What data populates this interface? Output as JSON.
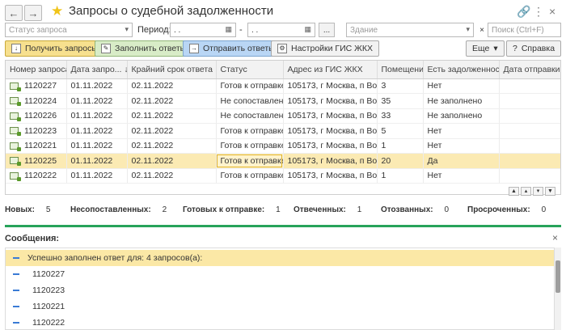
{
  "window": {
    "title": "Запросы о судебной задолженности",
    "back_icon": "←",
    "forward_icon": "→"
  },
  "filters": {
    "status_placeholder": "Статус запроса",
    "period_label": "Период:",
    "date_from": " .  .",
    "date_separator": "-",
    "date_to": " .  .",
    "period_button": "...",
    "building_placeholder": "Здание",
    "more_label": "Еще",
    "search_placeholder": "Поиск (Ctrl+F)"
  },
  "toolbar": {
    "get_requests": "Получить запросы",
    "fill_answers": "Заполнить ответы",
    "send_answers": "Отправить ответы",
    "gis_settings": "Настройки ГИС ЖКХ",
    "more": "Еще",
    "help": "Справка",
    "colors": {
      "get": "#f7e08e",
      "fill": "#d8ecc7",
      "send": "#b9d6f5",
      "neutral": "#f2f2f2"
    }
  },
  "table": {
    "headers": [
      "Номер запроса",
      "Дата запро...",
      "Крайний срок ответа",
      "Статус",
      "Адрес из ГИС ЖКХ",
      "Помещение",
      "Есть задолженность",
      "Дата отправки"
    ],
    "sort_indicator": "↓",
    "rows": [
      {
        "num": "1120227",
        "date": "01.11.2022",
        "deadline": "02.11.2022",
        "status": "Готов к отправке",
        "address": "105173, г Москва, п Во...",
        "room": "3",
        "debt": "Нет",
        "sent": ""
      },
      {
        "num": "1120224",
        "date": "01.11.2022",
        "deadline": "02.11.2022",
        "status": "Не сопоставлен",
        "address": "105173, г Москва, п Во...",
        "room": "35",
        "debt": "Не заполнено",
        "sent": ""
      },
      {
        "num": "1120226",
        "date": "01.11.2022",
        "deadline": "02.11.2022",
        "status": "Не сопоставлен",
        "address": "105173, г Москва, п Во...",
        "room": "33",
        "debt": "Не заполнено",
        "sent": ""
      },
      {
        "num": "1120223",
        "date": "01.11.2022",
        "deadline": "02.11.2022",
        "status": "Готов к отправке",
        "address": "105173, г Москва, п Во...",
        "room": "5",
        "debt": "Нет",
        "sent": ""
      },
      {
        "num": "1120221",
        "date": "01.11.2022",
        "deadline": "02.11.2022",
        "status": "Готов к отправке",
        "address": "105173, г Москва, п Во...",
        "room": "1",
        "debt": "Нет",
        "sent": ""
      },
      {
        "num": "1120225",
        "date": "01.11.2022",
        "deadline": "02.11.2022",
        "status": "Готов к отправке",
        "address": "105173, г Москва, п Во...",
        "room": "20",
        "debt": "Да",
        "sent": ""
      },
      {
        "num": "1120222",
        "date": "01.11.2022",
        "deadline": "02.11.2022",
        "status": "Готов к отправке",
        "address": "105173, г Москва, п Во...",
        "room": "1",
        "debt": "Нет",
        "sent": ""
      }
    ],
    "selected_row": 5
  },
  "counters": {
    "new_label": "Новых:",
    "new_value": "5",
    "unmatched_label": "Несопоставленных:",
    "unmatched_value": "2",
    "ready_label": "Готовых к отправке:",
    "ready_value": "1",
    "answered_label": "Отвеченных:",
    "answered_value": "1",
    "recalled_label": "Отозванных:",
    "recalled_value": "0",
    "overdue_label": "Просроченных:",
    "overdue_value": "0"
  },
  "messages": {
    "title": "Сообщения:",
    "close_icon": "×",
    "items": [
      "Успешно заполнен ответ для: 4 запросов(а):",
      "1120227",
      "1120223",
      "1120221",
      "1120222"
    ]
  }
}
